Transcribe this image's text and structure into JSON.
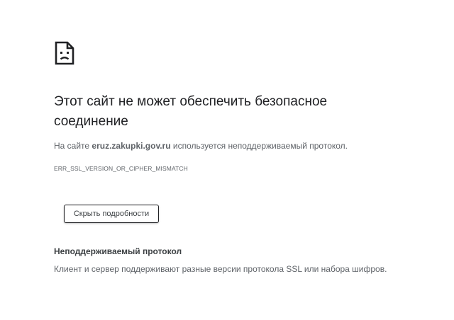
{
  "error_page": {
    "icon": "sad-page-icon",
    "title": "Этот сайт не может обеспечить безопасное соединение",
    "description": {
      "prefix": "На сайте ",
      "host": "eruz.zakupki.gov.ru",
      "suffix": " используется неподдерживаемый протокол."
    },
    "error_code": "ERR_SSL_VERSION_OR_CIPHER_MISMATCH",
    "details_button_label": "Скрыть подробности",
    "details": {
      "heading": "Неподдерживаемый протокол",
      "text": "Клиент и сервер поддерживают разные версии протокола SSL или набора шифров."
    }
  },
  "colors": {
    "background": "#ffffff",
    "title": "#202124",
    "secondary_text": "#5f6368"
  }
}
